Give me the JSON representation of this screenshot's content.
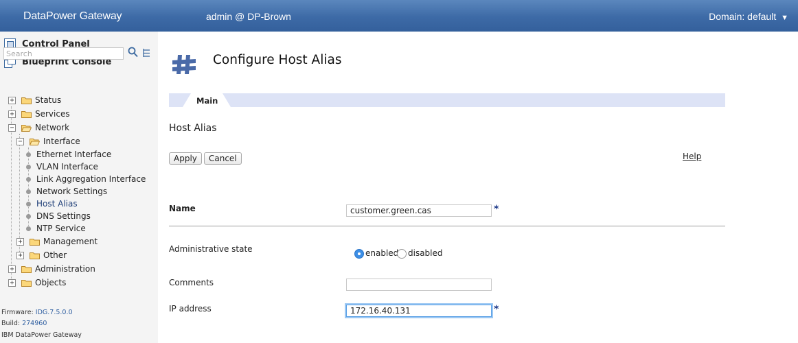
{
  "header": {
    "brand": "DataPower Gateway",
    "user": "admin @ DP-Brown",
    "domain_label": "Domain: default",
    "domain_caret": "▼"
  },
  "sidebar": {
    "control_panel": "Control Panel",
    "blueprint_console": "Blueprint Console",
    "search_placeholder": "Search",
    "tree": [
      {
        "label": "Status",
        "toggle": "+"
      },
      {
        "label": "Services",
        "toggle": "+"
      },
      {
        "label": "Network",
        "toggle": "−"
      },
      {
        "label": "Interface",
        "toggle": "−"
      },
      {
        "label": "Ethernet Interface"
      },
      {
        "label": "VLAN Interface"
      },
      {
        "label": "Link Aggregation Interface"
      },
      {
        "label": "Network Settings"
      },
      {
        "label": "Host Alias",
        "selected": true
      },
      {
        "label": "DNS Settings"
      },
      {
        "label": "NTP Service"
      },
      {
        "label": "Management",
        "toggle": "+"
      },
      {
        "label": "Other",
        "toggle": "+"
      },
      {
        "label": "Administration",
        "toggle": "+"
      },
      {
        "label": "Objects",
        "toggle": "+"
      }
    ],
    "footer": {
      "firmware_label": "Firmware:",
      "firmware_value": "IDG.7.5.0.0",
      "build_label": "Build:",
      "build_value": "274960",
      "product": "IBM DataPower Gateway"
    }
  },
  "main": {
    "page_title": "Configure Host Alias",
    "tab": "Main",
    "section_title": "Host Alias",
    "apply_label": "Apply",
    "cancel_label": "Cancel",
    "help_label": "Help",
    "required_mark": "*",
    "fields": {
      "name_label": "Name",
      "name_value": "customer.green.cas",
      "admin_state_label": "Administrative state",
      "enabled_label": "enabled",
      "disabled_label": "disabled",
      "admin_state_selected": "enabled",
      "comments_label": "Comments",
      "comments_value": "",
      "ip_label": "IP address",
      "ip_value": "172.16.40.131"
    }
  },
  "colors": {
    "header": "#3d6aa6",
    "tab_bar": "#dde3f6",
    "required": "#1e3a8a",
    "radio_on": "#3d8fe6"
  }
}
